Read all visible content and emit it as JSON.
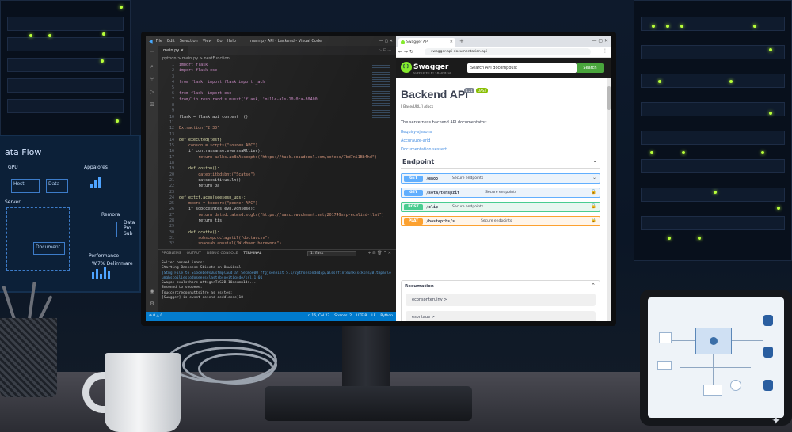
{
  "background_monitor": {
    "title": "ata Flow",
    "labels": [
      "GPU",
      "Appalores",
      "Host",
      "Data",
      "Server",
      "Remora",
      "Data Pro Sub",
      "Document",
      "Performance",
      "W.7% Delimmare"
    ]
  },
  "vscode": {
    "window_title": "main.py API - backend - Visual Code",
    "menu": [
      "File",
      "Edit",
      "Selection",
      "View",
      "Go",
      "Help"
    ],
    "tab_label": "main.py",
    "breadcrumb": "python > main.py > nextFunction",
    "line_numbers": [
      "1",
      "2",
      "3",
      "4",
      "5",
      "6",
      "7",
      "8",
      "9",
      "10",
      "11",
      "12",
      "13",
      "14",
      "15",
      "16",
      "17",
      "18",
      "19",
      "20",
      "21",
      "22",
      "23",
      "24",
      "25",
      "26",
      "27",
      "28",
      "29",
      "30",
      "31",
      "32"
    ],
    "code_lines": [
      "import flask",
      "import flask ese",
      "",
      "from flask, import flask import _ach",
      "",
      "from flask, import ese",
      "from/lib.reso.randis.musst('flask, 'mille-als-10-0ca-80400.",
      "",
      "",
      "flask = flask.api_content__()",
      "",
      "Extraction(\"2.30\"",
      "",
      "def executed(test):",
      "    conson = scrpts(\"sounen APC\")",
      "    if contrassanse.everssaRllier):",
      "        return aalbs.aoBsAssenpts(\"https://task.coaudoesl.com/sotess/7bd7nl1Bb4hd\")",
      "",
      "    def coston():",
      "        catebtitbdsbnt(\"Scatse\")",
      "        catscosititusiln()",
      "        return 0a",
      "",
      "def extct.acen(seesesn_ups):",
      "    meore = tocesro(\"pecner APC\")",
      "    if sobccesntes.evn.vonsese):",
      "        return datsd.tatmsd.scgls(\"https://saxc.swuchmsnt.ant/201749srp-ecmlisd-tlat\")",
      "        return tis",
      "",
      "    def dcotte():",
      "        sobscep.oclagntil(\"doctaccsv\")",
      "        snaosab.annsinl(\"Widbuer.borewore\")"
    ],
    "panel_tabs": [
      "PROBLEMS",
      "OUTPUT",
      "DEBUG CONSOLE",
      "TERMINAL"
    ],
    "panel_select": "1: flask",
    "terminal_lines": [
      "Switer bossed inons:",
      "Starting Banssese Sbiocte on Onwiisal:",
      "[Stmg File to Siocebe0s0ustmplaud at Setmoe00 ffgjseneist 5.1/2ythonsondsd/p/alsslfinteunksscksns/Bltmparle",
      "umqhscoiliessodoseersclastsbsoeitigsde/ssl.1-01",
      "Swagoe svulsthore attsgorTeS2B.10eeumm1ds...",
      "Snsonnd to soobeee:",
      "Touccercredonnuttsitre as ssstes:",
      "[Swagger] is ewsst ooiend aeddleese)18"
    ],
    "status_left": "⊗ 0 △ 0",
    "status_right": [
      "Ln 16, Col 27",
      "Spaces: 2",
      "UTF-8",
      "LF",
      "Python"
    ]
  },
  "browser": {
    "tab_title": "Swagger API Documentation",
    "url": "swagger.api-documentation.api",
    "swagger": {
      "brand": "Swagger",
      "brand_sub": "SUPPORTED BY SMARTBEAR",
      "search_placeholder": "Search API docompoust",
      "search_button": "Search",
      "api_title": "Backend API",
      "version_badge": "1.21",
      "oas_badge": "OAS3",
      "base_url": "[ Base/URL ] /docs",
      "description": "The serverness backend API documentator:",
      "links": [
        "Requiry-sjasons",
        "Accurauze-arid",
        "Documentation sessert"
      ],
      "section_title": "Endpoint",
      "operations": [
        {
          "method": "GET",
          "path": "/enoo",
          "summary": "Secure endpoints",
          "kind": "get",
          "icon": "chevron-down-icon"
        },
        {
          "method": "GET",
          "path": "/sota/tenspzit",
          "summary": "Secure endpoints",
          "kind": "get",
          "icon": "lock-icon"
        },
        {
          "method": "POST",
          "path": "/clip",
          "summary": "Secure endpoints",
          "kind": "post",
          "icon": "lock-icon"
        },
        {
          "method": "PLAT",
          "path": "/basteptbs/s",
          "summary": "Secure endpoints",
          "kind": "patch",
          "icon": "lock-icon"
        }
      ],
      "models_title": "Resumation",
      "models": [
        "econsonteruiny  >",
        "esontaue  >"
      ]
    }
  },
  "colors": {
    "vscode_blue": "#007acc",
    "swagger_green": "#85ea2d",
    "get": "#61affe",
    "post": "#49cc90",
    "patch": "#fca130",
    "led": "#b8ff3a"
  }
}
